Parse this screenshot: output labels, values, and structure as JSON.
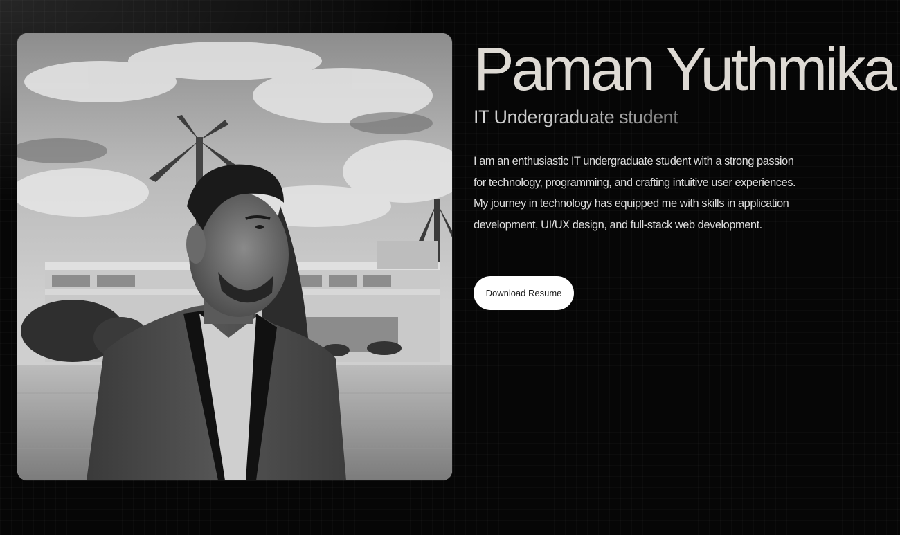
{
  "hero": {
    "name": "Paman Yuthmika",
    "subtitle": "IT Undergraduate student",
    "bio": "I am an enthusiastic IT undergraduate student with a strong passion for technology, programming, and crafting intuitive user experiences. My journey in technology has equipped me with skills in application development, UI/UX design, and full-stack web development.",
    "resume_button_label": "Download Resume"
  },
  "colors": {
    "background": "#050505",
    "name_text": "#dedad4",
    "button_bg": "#ffffff",
    "button_text": "#1a1a1a"
  },
  "icons": {
    "photo": "portrait-photo"
  }
}
